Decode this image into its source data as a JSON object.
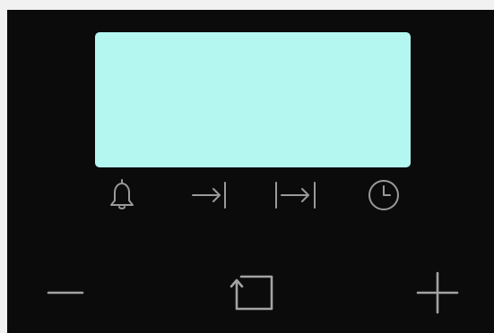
{
  "display": {
    "background_color": "#b4f7f1",
    "text": ""
  },
  "timer_buttons": [
    {
      "icon": "bell-icon",
      "function": "alarm"
    },
    {
      "icon": "arrow-to-bar-right-icon",
      "function": "duration"
    },
    {
      "icon": "bar-arrow-bar-icon",
      "function": "end-time"
    },
    {
      "icon": "clock-icon",
      "function": "clock"
    }
  ],
  "control_buttons": [
    {
      "icon": "minus-icon",
      "function": "decrease"
    },
    {
      "icon": "corner-arrow-square-icon",
      "function": "mode"
    },
    {
      "icon": "plus-icon",
      "function": "increase"
    }
  ],
  "colors": {
    "panel": "#0b0b0b",
    "icons": "#9a9a9a",
    "page_background": "#f1f1f1"
  }
}
